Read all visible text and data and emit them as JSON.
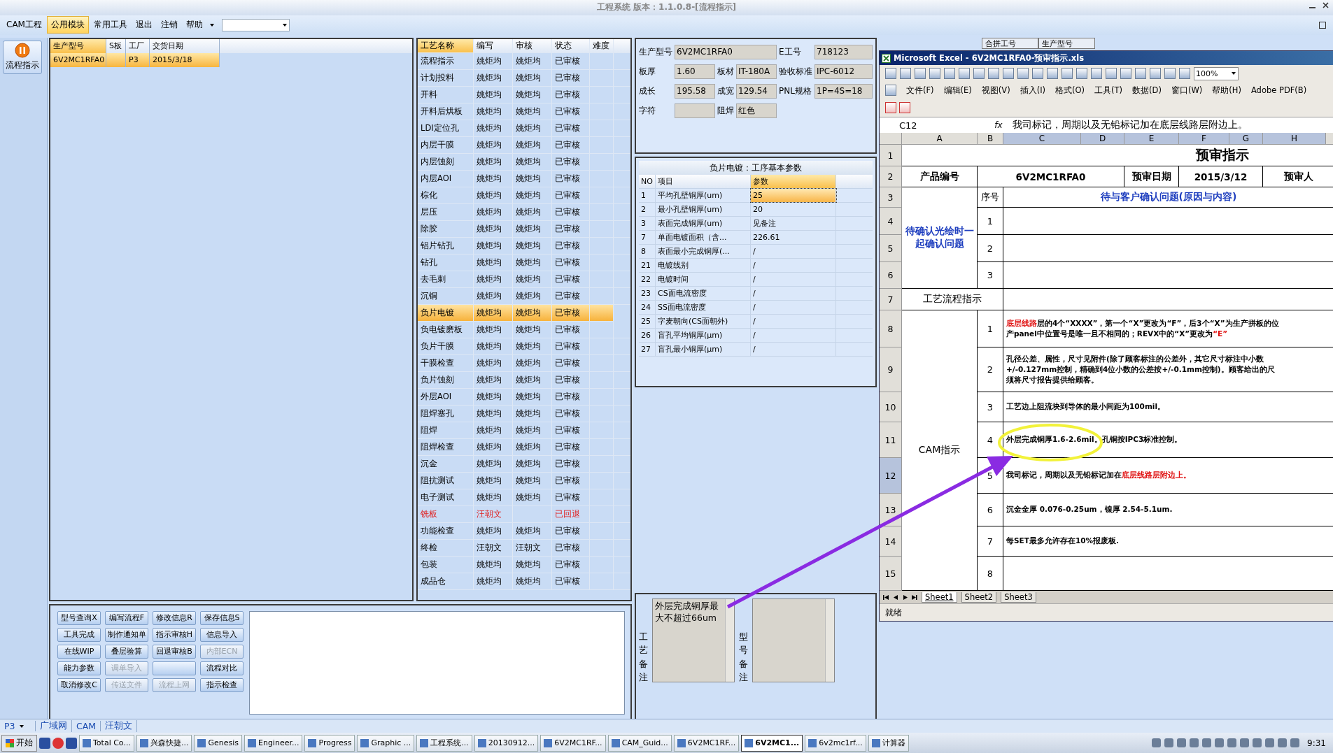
{
  "window": {
    "title": "工程系统 版本：1.1.0.8-[流程指示]"
  },
  "menu": [
    {
      "label": "CAM工程",
      "selected": false
    },
    {
      "label": "公用模块",
      "selected": true
    },
    {
      "label": "常用工具",
      "selected": false
    },
    {
      "label": "退出",
      "selected": false
    },
    {
      "label": "注销",
      "selected": false
    },
    {
      "label": "帮助",
      "selected": false
    }
  ],
  "side_tool": {
    "label": "流程指示"
  },
  "orders": {
    "columns": [
      "生产型号",
      "S板",
      "工厂",
      "交货日期"
    ],
    "rows": [
      {
        "cells": [
          "6V2MC1RFA0",
          "",
          "P3",
          "2015/3/18"
        ],
        "selected": true
      }
    ]
  },
  "process": {
    "columns": [
      "工艺名称",
      "编写",
      "审核",
      "状态",
      "难度"
    ],
    "rows": [
      {
        "name": "流程指示",
        "writer": "姚炬均",
        "reviewer": "姚炬均",
        "status": "已审核",
        "returned": false,
        "selected": false
      },
      {
        "name": "计划投料",
        "writer": "姚炬均",
        "reviewer": "姚炬均",
        "status": "已审核",
        "returned": false,
        "selected": false
      },
      {
        "name": "开料",
        "writer": "姚炬均",
        "reviewer": "姚炬均",
        "status": "已审核",
        "returned": false,
        "selected": false
      },
      {
        "name": "开料后烘板",
        "writer": "姚炬均",
        "reviewer": "姚炬均",
        "status": "已审核",
        "returned": false,
        "selected": false
      },
      {
        "name": "LDI定位孔",
        "writer": "姚炬均",
        "reviewer": "姚炬均",
        "status": "已审核",
        "returned": false,
        "selected": false
      },
      {
        "name": "内层干膜",
        "writer": "姚炬均",
        "reviewer": "姚炬均",
        "status": "已审核",
        "returned": false,
        "selected": false
      },
      {
        "name": "内层蚀刻",
        "writer": "姚炬均",
        "reviewer": "姚炬均",
        "status": "已审核",
        "returned": false,
        "selected": false
      },
      {
        "name": "内层AOI",
        "writer": "姚炬均",
        "reviewer": "姚炬均",
        "status": "已审核",
        "returned": false,
        "selected": false
      },
      {
        "name": "棕化",
        "writer": "姚炬均",
        "reviewer": "姚炬均",
        "status": "已审核",
        "returned": false,
        "selected": false
      },
      {
        "name": "层压",
        "writer": "姚炬均",
        "reviewer": "姚炬均",
        "status": "已审核",
        "returned": false,
        "selected": false
      },
      {
        "name": "除胶",
        "writer": "姚炬均",
        "reviewer": "姚炬均",
        "status": "已审核",
        "returned": false,
        "selected": false
      },
      {
        "name": "铝片钻孔",
        "writer": "姚炬均",
        "reviewer": "姚炬均",
        "status": "已审核",
        "returned": false,
        "selected": false
      },
      {
        "name": "钻孔",
        "writer": "姚炬均",
        "reviewer": "姚炬均",
        "status": "已审核",
        "returned": false,
        "selected": false
      },
      {
        "name": "去毛刺",
        "writer": "姚炬均",
        "reviewer": "姚炬均",
        "status": "已审核",
        "returned": false,
        "selected": false
      },
      {
        "name": "沉铜",
        "writer": "姚炬均",
        "reviewer": "姚炬均",
        "status": "已审核",
        "returned": false,
        "selected": false
      },
      {
        "name": "负片电镀",
        "writer": "姚炬均",
        "reviewer": "姚炬均",
        "status": "已审核",
        "returned": false,
        "selected": true
      },
      {
        "name": "负电镀磨板",
        "writer": "姚炬均",
        "reviewer": "姚炬均",
        "status": "已审核",
        "returned": false,
        "selected": false
      },
      {
        "name": "负片干膜",
        "writer": "姚炬均",
        "reviewer": "姚炬均",
        "status": "已审核",
        "returned": false,
        "selected": false
      },
      {
        "name": "干膜检查",
        "writer": "姚炬均",
        "reviewer": "姚炬均",
        "status": "已审核",
        "returned": false,
        "selected": false
      },
      {
        "name": "负片蚀刻",
        "writer": "姚炬均",
        "reviewer": "姚炬均",
        "status": "已审核",
        "returned": false,
        "selected": false
      },
      {
        "name": "外层AOI",
        "writer": "姚炬均",
        "reviewer": "姚炬均",
        "status": "已审核",
        "returned": false,
        "selected": false
      },
      {
        "name": "阻焊塞孔",
        "writer": "姚炬均",
        "reviewer": "姚炬均",
        "status": "已审核",
        "returned": false,
        "selected": false
      },
      {
        "name": "阻焊",
        "writer": "姚炬均",
        "reviewer": "姚炬均",
        "status": "已审核",
        "returned": false,
        "selected": false
      },
      {
        "name": "阻焊检查",
        "writer": "姚炬均",
        "reviewer": "姚炬均",
        "status": "已审核",
        "returned": false,
        "selected": false
      },
      {
        "name": "沉金",
        "writer": "姚炬均",
        "reviewer": "姚炬均",
        "status": "已审核",
        "returned": false,
        "selected": false
      },
      {
        "name": "阻抗测试",
        "writer": "姚炬均",
        "reviewer": "姚炬均",
        "status": "已审核",
        "returned": false,
        "selected": false
      },
      {
        "name": "电子测试",
        "writer": "姚炬均",
        "reviewer": "姚炬均",
        "status": "已审核",
        "returned": false,
        "selected": false
      },
      {
        "name": "铣板",
        "writer": "汪朝文",
        "reviewer": "",
        "status": "已回退",
        "returned": true,
        "selected": false
      },
      {
        "name": "功能检查",
        "writer": "姚炬均",
        "reviewer": "姚炬均",
        "status": "已审核",
        "returned": false,
        "selected": false
      },
      {
        "name": "终检",
        "writer": "汪朝文",
        "reviewer": "汪朝文",
        "status": "已审核",
        "returned": false,
        "selected": false
      },
      {
        "name": "包装",
        "writer": "姚炬均",
        "reviewer": "姚炬均",
        "status": "已审核",
        "returned": false,
        "selected": false
      },
      {
        "name": "成品仓",
        "writer": "姚炬均",
        "reviewer": "姚炬均",
        "status": "已审核",
        "returned": false,
        "selected": false
      }
    ]
  },
  "buttons": [
    {
      "label": "型号查询X",
      "disabled": false
    },
    {
      "label": "编写流程F",
      "disabled": false
    },
    {
      "label": "修改信息R",
      "disabled": false
    },
    {
      "label": "保存信息S",
      "disabled": false
    },
    {
      "label": "工具完成",
      "disabled": false
    },
    {
      "label": "制作通知单",
      "disabled": false
    },
    {
      "label": "指示审核H",
      "disabled": false
    },
    {
      "label": "信息导入",
      "disabled": false
    },
    {
      "label": "在线WIP",
      "disabled": false
    },
    {
      "label": "叠层验算",
      "disabled": false
    },
    {
      "label": "回退审核B",
      "disabled": false
    },
    {
      "label": "内部ECN",
      "disabled": true
    },
    {
      "label": "能力参数",
      "disabled": false
    },
    {
      "label": "调单导入",
      "disabled": true
    },
    {
      "disabled": false
    },
    {
      "label": "流程对比",
      "disabled": false
    },
    {
      "label": "取消修改C",
      "disabled": false
    },
    {
      "label": "传送文件",
      "disabled": true
    },
    {
      "label": "流程上网",
      "disabled": true
    },
    {
      "label": "指示检查",
      "disabled": false
    }
  ],
  "info_fields": [
    {
      "label": "生产型号",
      "value": "6V2MC1RFA0"
    },
    {
      "label": "E工号",
      "value": "718123"
    },
    {
      "label": "板厚",
      "value": "1.60"
    },
    {
      "label": "板材",
      "value": "IT-180A"
    },
    {
      "label": "验收标准",
      "value": "IPC-6012"
    },
    {
      "label": "成长",
      "value": "195.58"
    },
    {
      "label": "成宽",
      "value": "129.54"
    },
    {
      "label": "PNL规格",
      "value": "1P=4S=18"
    },
    {
      "label": "字符"
    },
    {
      "label": "阻焊",
      "value": "红色"
    }
  ],
  "params": {
    "title": "负片电镀：工序基本参数",
    "columns": [
      "NO",
      "项目",
      "参数"
    ],
    "rows": [
      {
        "no": "1",
        "item": "平均孔壁铜厚(um)",
        "value": "25",
        "selected": true
      },
      {
        "no": "2",
        "item": "最小孔壁铜厚(um)",
        "value": "20",
        "selected": false
      },
      {
        "no": "3",
        "item": "表面完成铜厚(um)",
        "value": "见备注",
        "selected": false
      },
      {
        "no": "7",
        "item": "单面电镀面积（含...",
        "value": "226.61",
        "selected": false
      },
      {
        "no": "8",
        "item": "表面最小完成铜厚(...",
        "value": "/",
        "selected": false
      },
      {
        "no": "21",
        "item": "电镀线别",
        "value": "/",
        "selected": false
      },
      {
        "no": "22",
        "item": "电镀时间",
        "value": "/",
        "selected": false
      },
      {
        "no": "23",
        "item": "CS面电流密度",
        "value": "/",
        "selected": false
      },
      {
        "no": "24",
        "item": "SS面电流密度",
        "value": "/",
        "selected": false
      },
      {
        "no": "25",
        "item": "字麦朝向(CS面朝外)",
        "value": "/",
        "selected": false
      },
      {
        "no": "26",
        "item": "盲孔平均铜厚(μm)",
        "value": "/",
        "selected": false
      },
      {
        "no": "27",
        "item": "盲孔最小铜厚(μm)",
        "value": "/",
        "selected": false
      }
    ]
  },
  "remarks": [
    {
      "label": "工艺备注",
      "value": "外层完成铜厚最大不超过66um"
    },
    {
      "label": "型号备注"
    }
  ],
  "behind_headers": [
    "合拼工号",
    "生产型号"
  ],
  "excel": {
    "title": "Microsoft Excel - 6V2MC1RFA0-预审指示.xls",
    "zoom": "100%",
    "menu": [
      "文件(F)",
      "编辑(E)",
      "视图(V)",
      "插入(I)",
      "格式(O)",
      "工具(T)",
      "数据(D)",
      "窗口(W)",
      "帮助(H)",
      "Adobe PDF(B)"
    ],
    "name_box": "C12",
    "fx_label": "fx",
    "formula": "我司标记，周期以及无铅标记加在底层线路层附边上。",
    "columns": [
      {
        "label": "A",
        "selected": false
      },
      {
        "label": "B",
        "selected": false
      },
      {
        "label": "C",
        "selected": true
      },
      {
        "label": "D",
        "selected": true
      },
      {
        "label": "E",
        "selected": true
      },
      {
        "label": "F",
        "selected": true
      },
      {
        "label": "G",
        "selected": true
      },
      {
        "label": "H",
        "selected": true
      }
    ],
    "rows": [
      {
        "label": "1",
        "selected": false
      },
      {
        "label": "2",
        "selected": false
      },
      {
        "label": "3",
        "selected": false
      },
      {
        "label": "4",
        "selected": false
      },
      {
        "label": "5",
        "selected": false
      },
      {
        "label": "6",
        "selected": false
      },
      {
        "label": "7",
        "selected": false
      },
      {
        "label": "8",
        "selected": false
      },
      {
        "label": "9",
        "selected": false
      },
      {
        "label": "10",
        "selected": false
      },
      {
        "label": "11",
        "selected": false
      },
      {
        "label": "12",
        "selected": true
      },
      {
        "label": "13",
        "selected": false
      },
      {
        "label": "14",
        "selected": false
      },
      {
        "label": "15",
        "selected": false
      }
    ],
    "sheet_title": "预审指示",
    "product_label": "产品编号",
    "product": "6V2MC1RFA0",
    "date_label": "预审日期",
    "date": "2015/3/12",
    "reviewer_label": "预审人",
    "confirm_label": "待确认光绘时一起确认问题",
    "seq_label": "序号",
    "confirm_header": "待与客户确认问题(原因与内容)",
    "confirm_rows": [
      "1",
      "2",
      "3"
    ],
    "flow_label": "工艺流程指示",
    "cam_label": "CAM指示",
    "instructions": [
      {
        "no": "1",
        "lines": [
          [
            {
              "text": "底层线路",
              "red": true
            },
            {
              "text": "层的4个“XXXX”，第一个“X”更改为“F”，后3个“X”为生产拼板的位",
              "red": false
            }
          ],
          [
            {
              "text": "产panel中位置号是唯一且不相同的；REVX中的“X”更改为",
              "red": false
            },
            {
              "text": "“E”",
              "red": true
            }
          ]
        ]
      },
      {
        "no": "2",
        "lines": [
          [
            {
              "text": "孔径公差、属性，尺寸见附件(除了顾客标注的公差外，其它尺寸标注中小数",
              "red": false
            }
          ],
          [
            {
              "text": "+/-0.127mm控制，精确到4位小数的公差按+/-0.1mm控制)。顾客给出的尺",
              "red": false
            }
          ],
          [
            {
              "text": "须将尺寸报告提供给顾客。",
              "red": false
            }
          ]
        ]
      },
      {
        "no": "3",
        "lines": [
          [
            {
              "text": "工艺边上阻流块到导体的最小间距为100mil。",
              "red": false
            }
          ]
        ]
      },
      {
        "no": "4",
        "lines": [
          [
            {
              "text": "外层完成铜厚1.6-2.6mil。",
              "red": false
            },
            {
              "text": "孔铜按IPC3标准控制。",
              "red": false
            }
          ]
        ]
      },
      {
        "no": "5",
        "lines": [
          [
            {
              "text": "我司标记，周期以及无铅标记加在",
              "red": false
            },
            {
              "text": "底层线路层附边上。",
              "red": true
            }
          ]
        ]
      },
      {
        "no": "6",
        "lines": [
          [
            {
              "text": "沉金金厚 0.076-0.25um，镍厚 2.54-5.1um.",
              "red": false
            }
          ]
        ]
      },
      {
        "no": "7",
        "lines": [
          [
            {
              "text": "每SET最多允许存在10%报废板.",
              "red": false
            }
          ]
        ]
      },
      {
        "no": "8"
      }
    ],
    "sheets": [
      {
        "label": "Sheet1",
        "selected": true
      },
      {
        "label": "Sheet2",
        "selected": false
      },
      {
        "label": "Sheet3",
        "selected": false
      }
    ],
    "status": "就绪"
  },
  "bottom_tabs": [
    {
      "label": "P3",
      "kind": "dropdown"
    },
    {
      "label": "广域网",
      "kind": "tab"
    },
    {
      "label": "CAM",
      "kind": "tab"
    },
    {
      "label": "汪朝文",
      "kind": "tab"
    }
  ],
  "taskbar": {
    "start": "开始",
    "items": [
      {
        "label": "Total Co...",
        "selected": false
      },
      {
        "label": "兴森快捷...",
        "selected": false
      },
      {
        "label": "Genesis",
        "selected": false
      },
      {
        "label": "Engineer...",
        "selected": false
      },
      {
        "label": "Progress",
        "selected": false
      },
      {
        "label": "Graphic ...",
        "selected": false
      },
      {
        "label": "工程系统...",
        "selected": false
      },
      {
        "label": "20130912...",
        "selected": false
      },
      {
        "label": "6V2MC1RF...",
        "selected": false
      },
      {
        "label": "CAM_Guid...",
        "selected": false
      },
      {
        "label": "6V2MC1RF...",
        "selected": false
      },
      {
        "label": "6V2MC1...",
        "selected": true
      },
      {
        "label": "6v2mc1rf...",
        "selected": false
      },
      {
        "label": "计算器",
        "selected": false
      }
    ],
    "clock": "9:31"
  }
}
